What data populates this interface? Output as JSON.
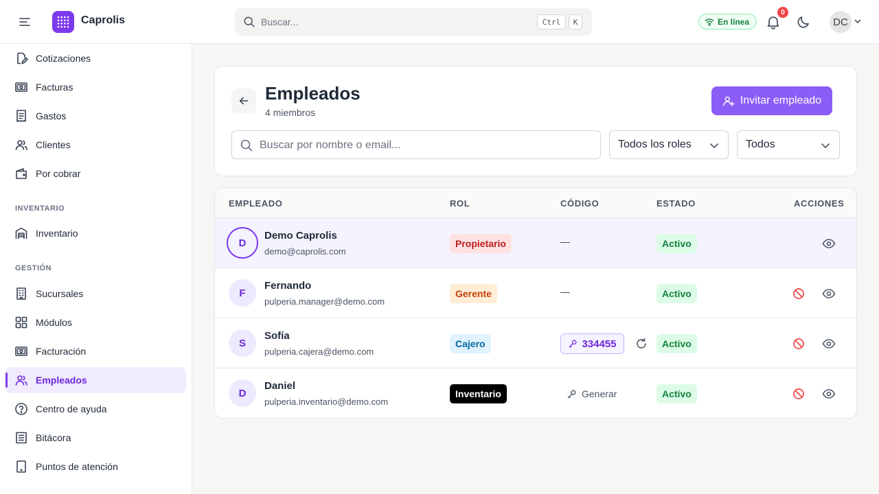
{
  "app": {
    "brand": "Caprolis",
    "search_placeholder": "Buscar...",
    "kbd_ctrl": "Ctrl",
    "kbd_k": "K",
    "online_label": "En línea",
    "notifications_count": "0",
    "user_initials": "DC"
  },
  "sidebar": {
    "items": [
      {
        "label": "Cotizaciones",
        "icon": "quote-edit-icon"
      },
      {
        "label": "Facturas",
        "icon": "banknote-icon"
      },
      {
        "label": "Gastos",
        "icon": "receipt-icon"
      },
      {
        "label": "Clientes",
        "icon": "users-icon"
      },
      {
        "label": "Por cobrar",
        "icon": "wallet-icon"
      }
    ],
    "section_inventario": "INVENTARIO",
    "inventario_items": [
      {
        "label": "Inventario",
        "icon": "warehouse-icon"
      }
    ],
    "section_gestion": "GESTIÓN",
    "gestion_items": [
      {
        "label": "Sucursales",
        "icon": "building-icon"
      },
      {
        "label": "Módulos",
        "icon": "grid-icon"
      },
      {
        "label": "Facturación",
        "icon": "banknote-icon"
      },
      {
        "label": "Empleados",
        "icon": "users-icon",
        "active": true
      },
      {
        "label": "Centro de ayuda",
        "icon": "help-circle-icon"
      },
      {
        "label": "Bitácora",
        "icon": "log-icon"
      },
      {
        "label": "Puntos de atención",
        "icon": "tablet-icon"
      }
    ]
  },
  "page": {
    "title": "Empleados",
    "subtitle": "4 miembros",
    "invite_label": "Invitar empleado",
    "search_placeholder": "Buscar por nombre o email...",
    "role_filter": "Todos los roles",
    "status_filter": "Todos"
  },
  "table": {
    "headers": {
      "employee": "EMPLEADO",
      "role": "ROL",
      "code": "CÓDIGO",
      "status": "ESTADO",
      "actions": "ACCIONES"
    },
    "rows": [
      {
        "initial": "D",
        "name": "Demo Caprolis",
        "email": "demo@caprolis.com",
        "role": "Propietario",
        "code": "—",
        "status": "Activo"
      },
      {
        "initial": "F",
        "name": "Fernando",
        "email": "pulperia.manager@demo.com",
        "role": "Gerente",
        "code": "—",
        "status": "Activo"
      },
      {
        "initial": "S",
        "name": "Sofía",
        "email": "pulperia.cajera@demo.com",
        "role": "Cajero",
        "code": "334455",
        "status": "Activo"
      },
      {
        "initial": "D",
        "name": "Daniel",
        "email": "pulperia.inventario@demo.com",
        "role": "Inventario",
        "code": "Generar",
        "status": "Activo"
      }
    ]
  },
  "colors": {
    "accent": "#7c3aed",
    "role_owner_bg": "#fee2e2",
    "role_owner_fg": "#b91c1c",
    "role_manager_bg": "#ffedd5",
    "role_manager_fg": "#c2410c",
    "role_cashier_bg": "#e0f2fe",
    "role_cashier_fg": "#0369a1",
    "role_inventory_bg": "#000000",
    "role_inventory_fg": "#ffffff",
    "status_active": "#15803d",
    "danger": "#ef4444"
  }
}
